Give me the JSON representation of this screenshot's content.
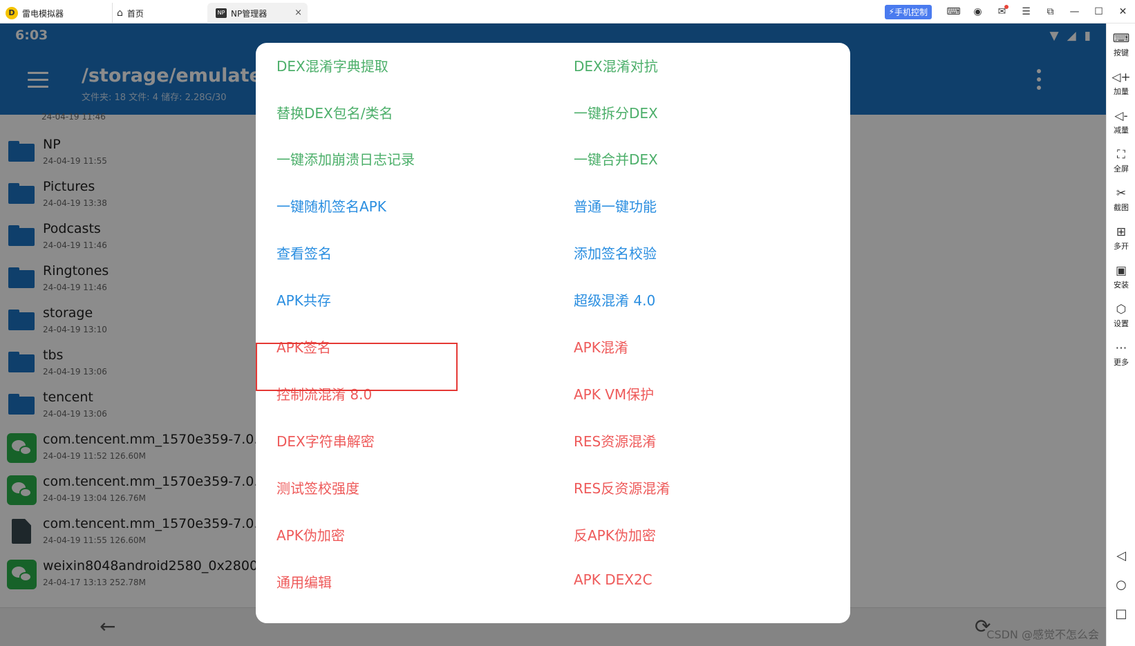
{
  "titlebar": {
    "app_tab": "雷电模拟器",
    "home_tab": "首页",
    "np_tab": "NP管理器",
    "tab_close": "×",
    "phone_control": "手机控制",
    "icons": [
      "gamepad-icon",
      "user-icon",
      "mail-icon",
      "hamburger-icon",
      "restore-icon",
      "minimize-icon",
      "maximize-icon",
      "close-icon"
    ],
    "icon_glyphs": [
      "⌨",
      "◉",
      "✉",
      "☰",
      "⧉",
      "—",
      "☐",
      "✕"
    ]
  },
  "statusbar": {
    "time": "6:03",
    "icons": [
      "▼",
      "◢",
      "▮"
    ]
  },
  "appbar": {
    "path": "/storage/emulated/",
    "subtitle": "文件夹: 18 文件: 4 储存: 2.28G/30"
  },
  "file_list": {
    "partial_top_date": "24-04-19 11:46",
    "items": [
      {
        "type": "folder",
        "name": "NP",
        "meta": "24-04-19 11:55"
      },
      {
        "type": "folder",
        "name": "Pictures",
        "meta": "24-04-19 13:38"
      },
      {
        "type": "folder",
        "name": "Podcasts",
        "meta": "24-04-19 11:46"
      },
      {
        "type": "folder",
        "name": "Ringtones",
        "meta": "24-04-19 11:46"
      },
      {
        "type": "folder",
        "name": "storage",
        "meta": "24-04-19 13:10"
      },
      {
        "type": "folder",
        "name": "tbs",
        "meta": "24-04-19 13:06"
      },
      {
        "type": "folder",
        "name": "tencent",
        "meta": "24-04-19 13:06"
      },
      {
        "type": "apk",
        "name": "com.tencent.mm_1570e359-7.0.9.ap",
        "meta": "24-04-19 11:52  126.60M"
      },
      {
        "type": "apk",
        "name": "com.tencent.mm_1570e359-7.0.9_s",
        "meta": "24-04-19 13:04  126.76M"
      },
      {
        "type": "file",
        "name": "com.tencent.mm_1570e359-7.0.9_s",
        "meta": "24-04-19 11:55  126.60M"
      },
      {
        "type": "apk",
        "name": "weixin8048android2580_0x2800303",
        "meta": "24-04-17 13:13  252.78M"
      }
    ]
  },
  "dialog": {
    "left": [
      {
        "label": "DEX混淆字典提取",
        "color": "green"
      },
      {
        "label": "替换DEX包名/类名",
        "color": "green"
      },
      {
        "label": "一键添加崩溃日志记录",
        "color": "green"
      },
      {
        "label": "一键随机签名APK",
        "color": "blue"
      },
      {
        "label": "查看签名",
        "color": "blue"
      },
      {
        "label": "APK共存",
        "color": "blue"
      },
      {
        "label": "APK签名",
        "color": "red"
      },
      {
        "label": "控制流混淆 8.0",
        "color": "red"
      },
      {
        "label": "DEX字符串解密",
        "color": "red"
      },
      {
        "label": "测试签校强度",
        "color": "red"
      },
      {
        "label": "APK伪加密",
        "color": "red"
      },
      {
        "label": "通用编辑",
        "color": "red"
      }
    ],
    "right": [
      {
        "label": "DEX混淆对抗",
        "color": "green"
      },
      {
        "label": "一键拆分DEX",
        "color": "green"
      },
      {
        "label": "一键合并DEX",
        "color": "green"
      },
      {
        "label": "普通一键功能",
        "color": "blue"
      },
      {
        "label": "添加签名校验",
        "color": "blue"
      },
      {
        "label": "超级混淆 4.0",
        "color": "blue"
      },
      {
        "label": "APK混淆",
        "color": "red"
      },
      {
        "label": "APK VM保护",
        "color": "red"
      },
      {
        "label": "RES资源混淆",
        "color": "red"
      },
      {
        "label": "RES反资源混淆",
        "color": "red"
      },
      {
        "label": "反APK伪加密",
        "color": "red"
      },
      {
        "label": "APK DEX2C",
        "color": "red"
      }
    ],
    "highlighted": "APK签名"
  },
  "bottom_nav": {
    "back": "←",
    "refresh": "⟳"
  },
  "right_toolbar": {
    "buttons": [
      {
        "label": "按键",
        "icon": "keyboard-icon",
        "glyph": "⌨"
      },
      {
        "label": "加量",
        "icon": "volume-up-icon",
        "glyph": "◁+"
      },
      {
        "label": "减量",
        "icon": "volume-down-icon",
        "glyph": "◁-"
      },
      {
        "label": "全屏",
        "icon": "fullscreen-icon",
        "glyph": "⛶"
      },
      {
        "label": "截图",
        "icon": "scissors-icon",
        "glyph": "✂"
      },
      {
        "label": "多开",
        "icon": "multi-instance-icon",
        "glyph": "⊞"
      },
      {
        "label": "安装",
        "icon": "apk-install-icon",
        "glyph": "▣"
      },
      {
        "label": "设置",
        "icon": "settings-icon",
        "glyph": "⬡"
      },
      {
        "label": "更多",
        "icon": "more-icon",
        "glyph": "⋯"
      }
    ],
    "nav": [
      "◁",
      "○",
      "□"
    ]
  },
  "watermark": "CSDN @感觉不怎么会",
  "colors": {
    "appbar": "#1c74c4",
    "green": "#4caf6a",
    "blue": "#2a8ee0",
    "red": "#ee5a5a",
    "highlight": "#e53935"
  }
}
